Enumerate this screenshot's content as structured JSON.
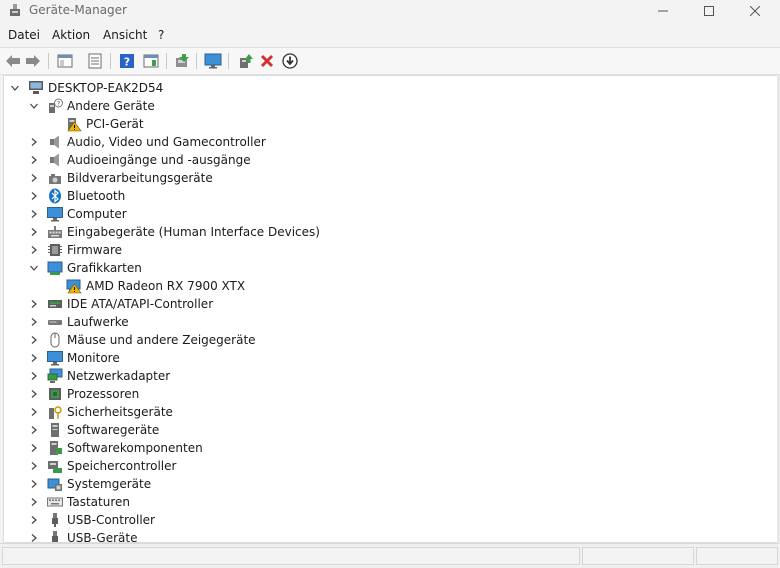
{
  "window": {
    "title": "Geräte-Manager",
    "controls": [
      "minimize-icon",
      "maximize-icon",
      "close-icon"
    ]
  },
  "menu": [
    "Datei",
    "Aktion",
    "Ansicht",
    "?"
  ],
  "toolbar": {
    "buttons": [
      "back-icon",
      "forward-icon",
      "show-hide-console-tree-icon",
      "properties-icon",
      "help-icon",
      "export-list-icon",
      "scan-hardware-changes-icon",
      "monitor-icon",
      "update-driver-icon",
      "uninstall-device-icon",
      "disable-device-icon"
    ]
  },
  "tree": {
    "root": "DESKTOP-EAK2D54",
    "nodes": [
      {
        "label": "Andere Geräte",
        "icon": "unknown-device-icon",
        "expanded": true,
        "children": [
          {
            "label": "PCI-Gerät",
            "icon": "warning-device-icon"
          }
        ]
      },
      {
        "label": "Audio, Video und Gamecontroller",
        "icon": "speaker-icon"
      },
      {
        "label": "Audioeingänge und -ausgänge",
        "icon": "speaker-icon"
      },
      {
        "label": "Bildverarbeitungsgeräte",
        "icon": "camera-icon"
      },
      {
        "label": "Bluetooth",
        "icon": "bluetooth-icon"
      },
      {
        "label": "Computer",
        "icon": "computer-icon"
      },
      {
        "label": "Eingabegeräte (Human Interface Devices)",
        "icon": "hid-icon"
      },
      {
        "label": "Firmware",
        "icon": "firmware-icon"
      },
      {
        "label": "Grafikkarten",
        "icon": "display-adapter-icon",
        "expanded": true,
        "children": [
          {
            "label": "AMD Radeon RX 7900 XTX",
            "icon": "display-adapter-warning-icon"
          }
        ]
      },
      {
        "label": "IDE ATA/ATAPI-Controller",
        "icon": "ide-controller-icon"
      },
      {
        "label": "Laufwerke",
        "icon": "disk-drive-icon"
      },
      {
        "label": "Mäuse und andere Zeigegeräte",
        "icon": "mouse-icon"
      },
      {
        "label": "Monitore",
        "icon": "monitor-icon"
      },
      {
        "label": "Netzwerkadapter",
        "icon": "network-adapter-icon"
      },
      {
        "label": "Prozessoren",
        "icon": "processor-icon"
      },
      {
        "label": "Sicherheitsgeräte",
        "icon": "security-device-icon"
      },
      {
        "label": "Softwaregeräte",
        "icon": "software-device-icon"
      },
      {
        "label": "Softwarekomponenten",
        "icon": "software-component-icon"
      },
      {
        "label": "Speichercontroller",
        "icon": "storage-controller-icon"
      },
      {
        "label": "Systemgeräte",
        "icon": "system-device-icon"
      },
      {
        "label": "Tastaturen",
        "icon": "keyboard-icon"
      },
      {
        "label": "USB-Controller",
        "icon": "usb-icon"
      },
      {
        "label": "USB-Geräte",
        "icon": "usb-icon"
      }
    ]
  },
  "colors": {
    "accent": "#1a73c8",
    "warning": "#f2b600",
    "error": "#d32f2f"
  }
}
